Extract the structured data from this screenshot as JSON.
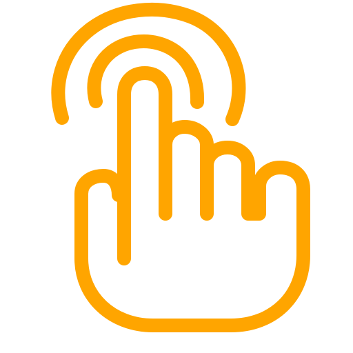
{
  "icon": {
    "name": "tap-gesture-icon",
    "color": "#FFA500"
  }
}
